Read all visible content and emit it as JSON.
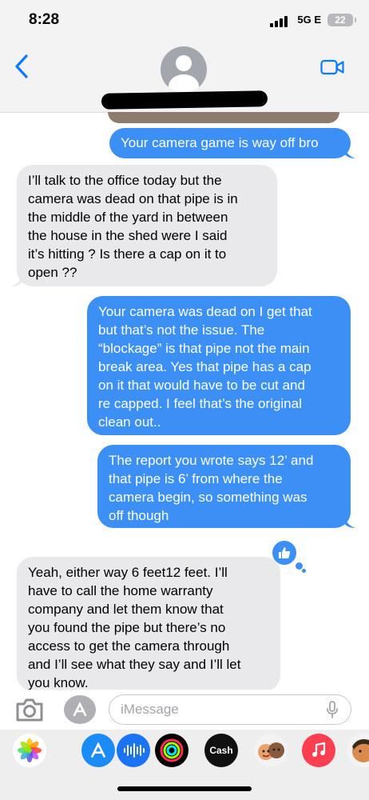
{
  "status_bar": {
    "time": "8:28",
    "network": "5G E",
    "battery": "22"
  },
  "messages": [
    {
      "dir": "out",
      "text": "Your camera game is way off bro"
    },
    {
      "dir": "in",
      "text": "I’ll talk to the office today but the\ncamera was dead on that pipe is in\nthe middle of the yard in between\nthe house in the shed were I said\nit’s hitting ? Is there a cap on it to\nopen ??"
    },
    {
      "dir": "out",
      "text": "Your camera was dead on I get that\nbut that’s not the issue.  The\n“blockage” is that pipe not the main\nbreak area.  Yes that pipe has a cap\non it that would have to be cut and\nre capped.  I feel that’s the original\nclean out.."
    },
    {
      "dir": "out",
      "text": "The report you wrote says 12’ and\nthat pipe is 6’ from where the\ncamera begin, so something was\noff though"
    },
    {
      "dir": "in",
      "text": "Yeah, either way 6 feet12 feet. I’ll\nhave to call the home warranty\ncompany and let them know that\nyou found the pipe but there’s no\naccess to get the camera through\nand I’ll see what they say and I’ll let\nyou know."
    }
  ],
  "input": {
    "placeholder": "iMessage"
  },
  "app_drawer": [
    {
      "name": "photos",
      "label": ""
    },
    {
      "name": "app-store",
      "label": ""
    },
    {
      "name": "audio",
      "label": ""
    },
    {
      "name": "activity",
      "label": ""
    },
    {
      "name": "cash",
      "label": "Cash"
    },
    {
      "name": "memoji",
      "label": ""
    },
    {
      "name": "music",
      "label": ""
    },
    {
      "name": "memoji-2",
      "label": ""
    }
  ],
  "colors": {
    "outgoing": "#3b8ff5",
    "incoming": "#e9e9eb",
    "accent": "#0a7aff"
  }
}
